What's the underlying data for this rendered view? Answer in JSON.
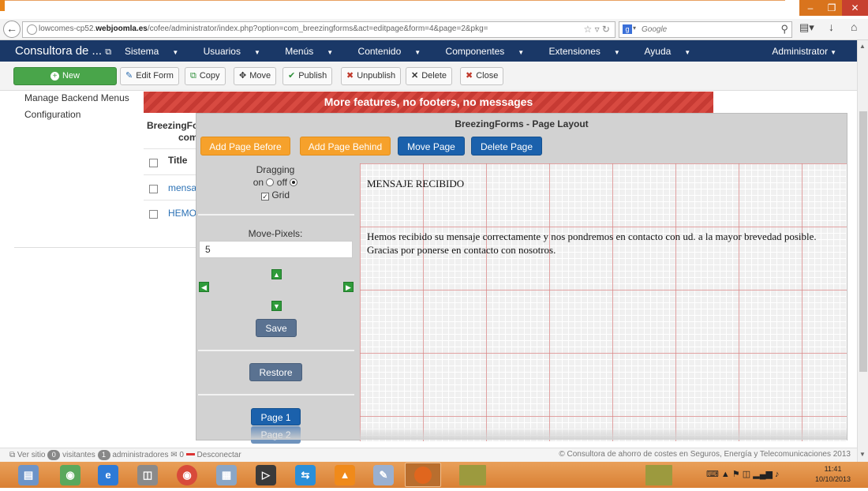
{
  "browser": {
    "url_prefix": "lowcomes-cp52.",
    "url_domain": "webjoomla.es",
    "url_path": "/cofee/administrator/index.php?option=com_breezingforms&act=editpage&form=4&page=2&pkg=",
    "search_placeholder": "Google"
  },
  "admin": {
    "site_name": "Consultora de ...",
    "menu": [
      "Sistema",
      "Usuarios",
      "Menús",
      "Contenido",
      "Componentes",
      "Extensiones",
      "Ayuda"
    ],
    "user": "Administrator"
  },
  "toolbar": {
    "new": "New",
    "edit_form": "Edit Form",
    "copy": "Copy",
    "move": "Move",
    "publish": "Publish",
    "unpublish": "Unpublish",
    "delete": "Delete",
    "close": "Close"
  },
  "sidebar": {
    "items": [
      "Manage Backend Menus",
      "Configuration"
    ]
  },
  "background": {
    "promo": "More features, no footers, no messages",
    "form_title_line1": "BreezingFo",
    "form_title_line2": "com",
    "title_header": "Title",
    "rows": [
      "mensaj",
      "HEMOS"
    ]
  },
  "layout": {
    "title": "BreezingForms - Page Layout",
    "buttons": {
      "add_before": "Add Page Before",
      "add_behind": "Add Page Behind",
      "move_page": "Move Page",
      "delete_page": "Delete Page"
    },
    "dragging_label": "Dragging",
    "on_label": "on",
    "off_label": "off",
    "dragging_on": false,
    "grid_label": "Grid",
    "grid_enabled": true,
    "move_pixels_label": "Move-Pixels:",
    "move_pixels_value": "5",
    "save": "Save",
    "restore": "Restore",
    "pages": [
      "Page 1",
      "Page 2"
    ],
    "canvas_heading": "MENSAJE RECIBIDO",
    "canvas_body": "Hemos recibido su mensaje correctamente y nos pondremos en contacto con ud. a la mayor brevedad posible. Gracias por ponerse en contacto con nosotros."
  },
  "status": {
    "view_site": "Ver sitio",
    "visitors_count": "0",
    "visitors_label": "visitantes",
    "admins_count": "1",
    "admins_label": "administradores",
    "messages_count": "0",
    "logout": "Desconectar",
    "copyright": "© Consultora de ahorro de costes en Seguros, Energía y Telecomunicaciones 2013"
  },
  "taskbar": {
    "time": "11:41",
    "date": "10/10/2013"
  },
  "colors": {
    "admin_nav": "#1a3867",
    "new_button": "#49a54a",
    "promo_red": "#d84a41",
    "orange_button": "#f6a12b",
    "blue_button": "#1b61ac"
  }
}
